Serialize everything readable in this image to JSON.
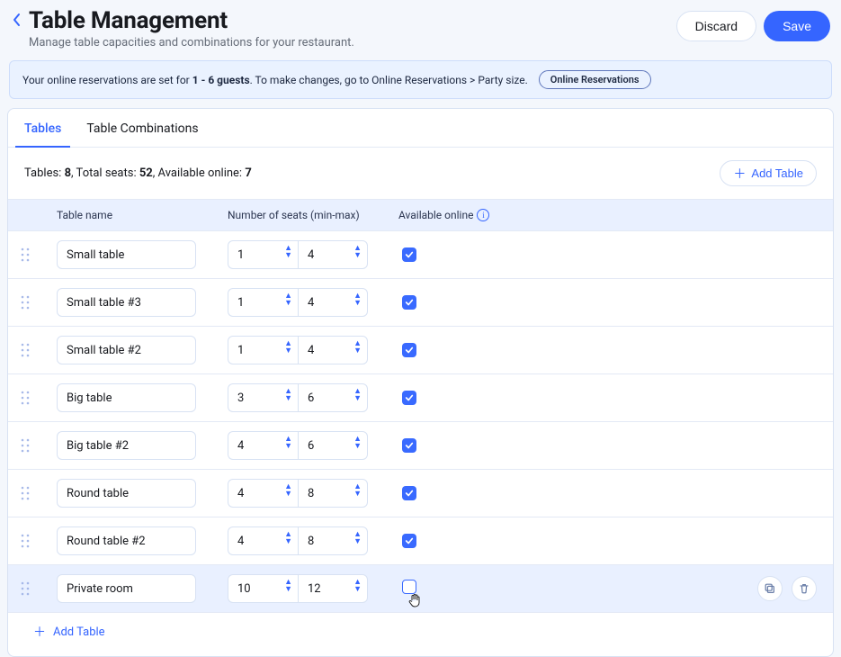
{
  "header": {
    "title": "Table Management",
    "subtitle": "Manage table capacities and combinations for your restaurant.",
    "discard": "Discard",
    "save": "Save"
  },
  "banner": {
    "prefix": "Your online reservations are set for ",
    "range": "1 - 6 guests",
    "suffix": ". To make changes, go to Online Reservations > Party size.",
    "pill": "Online Reservations"
  },
  "tabs": [
    {
      "id": "tables",
      "label": "Tables",
      "active": true
    },
    {
      "id": "combos",
      "label": "Table Combinations",
      "active": false
    }
  ],
  "stats": {
    "tables_label": "Tables: ",
    "tables_value": "8",
    "seats_label": ", Total seats: ",
    "seats_value": "52",
    "online_label": ", Available online: ",
    "online_value": "7"
  },
  "add_button": "Add Table",
  "columns": {
    "name": "Table name",
    "seats": "Number of seats (min-max)",
    "online": "Available online"
  },
  "rows": [
    {
      "name": "Small table",
      "min": "1",
      "max": "4",
      "online": true,
      "highlight": false
    },
    {
      "name": "Small table #3",
      "min": "1",
      "max": "4",
      "online": true,
      "highlight": false
    },
    {
      "name": "Small table #2",
      "min": "1",
      "max": "4",
      "online": true,
      "highlight": false
    },
    {
      "name": "Big table",
      "min": "3",
      "max": "6",
      "online": true,
      "highlight": false
    },
    {
      "name": "Big table #2",
      "min": "4",
      "max": "6",
      "online": true,
      "highlight": false
    },
    {
      "name": "Round table",
      "min": "4",
      "max": "8",
      "online": true,
      "highlight": false
    },
    {
      "name": "Round table #2",
      "min": "4",
      "max": "8",
      "online": true,
      "highlight": false
    },
    {
      "name": "Private room",
      "min": "10",
      "max": "12",
      "online": false,
      "highlight": true
    }
  ],
  "footer_add": "Add Table"
}
